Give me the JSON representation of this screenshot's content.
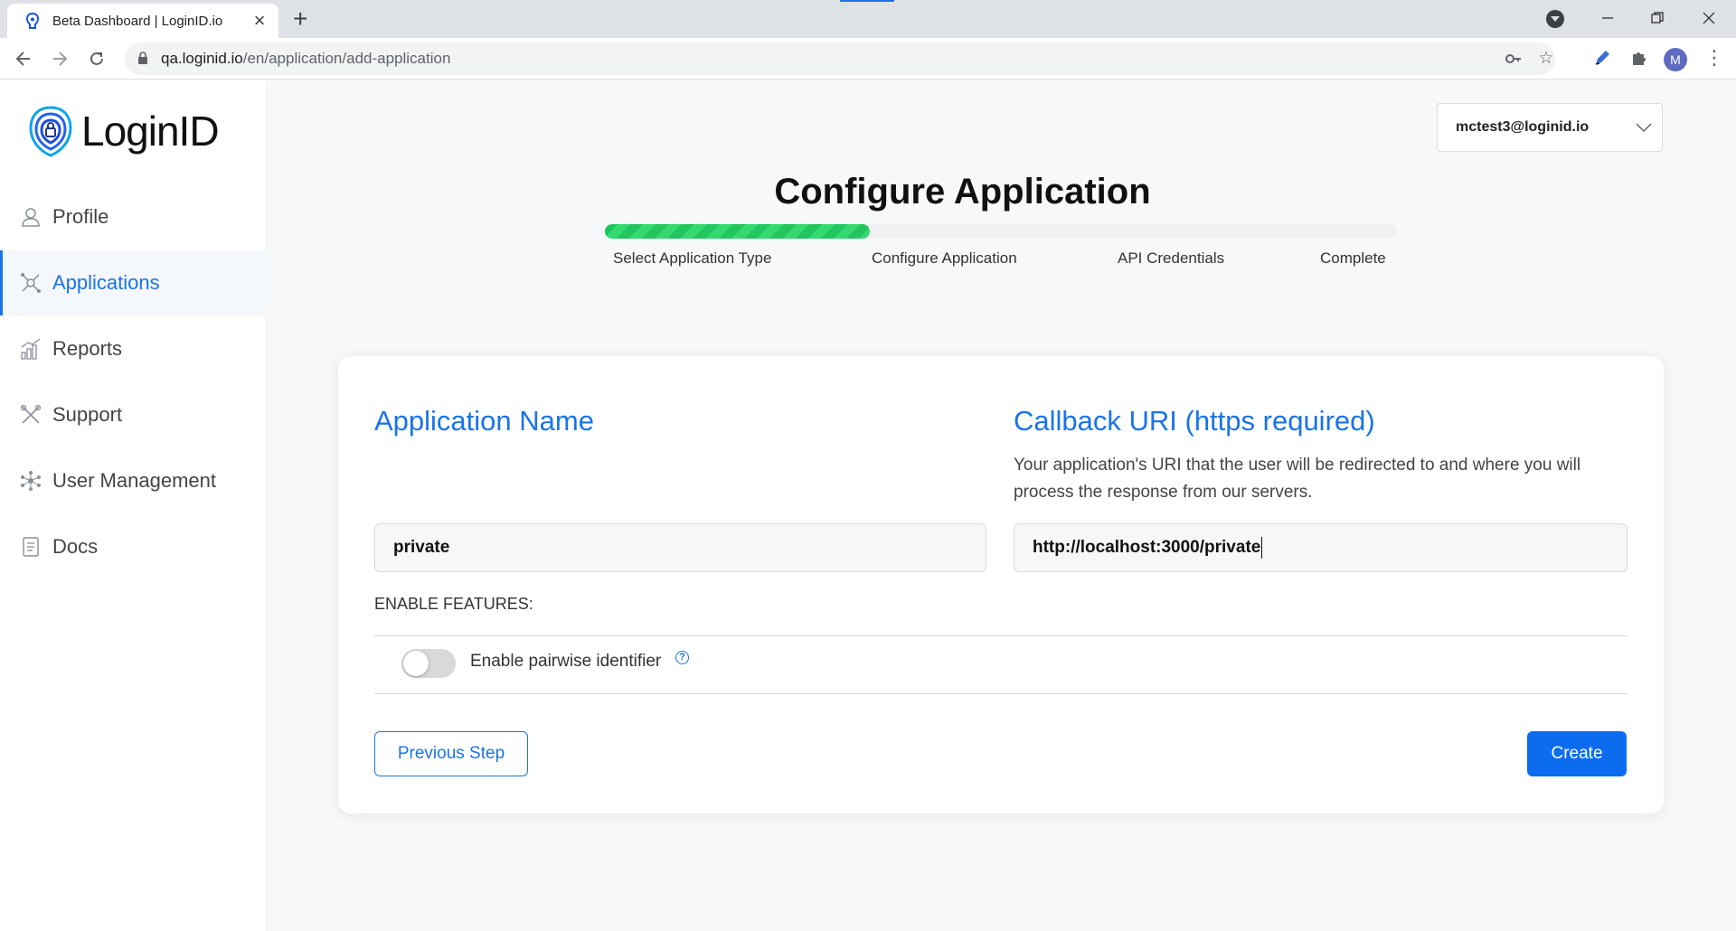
{
  "browser": {
    "tab_title": "Beta Dashboard | LoginID.io",
    "url_domain": "qa.loginid.io",
    "url_path": "/en/application/add-application",
    "profile_initial": "M"
  },
  "sidebar": {
    "brand": "LoginID",
    "items": [
      {
        "label": "Profile",
        "icon": "user-icon"
      },
      {
        "label": "Applications",
        "icon": "applications-icon",
        "active": true
      },
      {
        "label": "Reports",
        "icon": "bar-chart-icon"
      },
      {
        "label": "Support",
        "icon": "tools-icon"
      },
      {
        "label": "User Management",
        "icon": "network-icon"
      },
      {
        "label": "Docs",
        "icon": "document-icon"
      }
    ]
  },
  "header": {
    "account_email": "mctest3@loginid.io"
  },
  "wizard": {
    "title": "Configure Application",
    "progress_fraction": 0.335,
    "steps": [
      "Select Application Type",
      "Configure Application",
      "API Credentials",
      "Complete"
    ]
  },
  "form": {
    "app_name_title": "Application Name",
    "app_name_value": "private",
    "callback_title": "Callback URI (https required)",
    "callback_desc": "Your application's URI that the user will be redirected to and where you will process the response from our servers.",
    "callback_value": "http://localhost:3000/private",
    "features_label": "ENABLE FEATURES:",
    "pairwise_label": "Enable pairwise identifier",
    "pairwise_enabled": false,
    "help_glyph": "?",
    "prev_button": "Previous Step",
    "create_button": "Create"
  },
  "colors": {
    "accent": "#1a73e8",
    "progress": "#22c55e"
  }
}
